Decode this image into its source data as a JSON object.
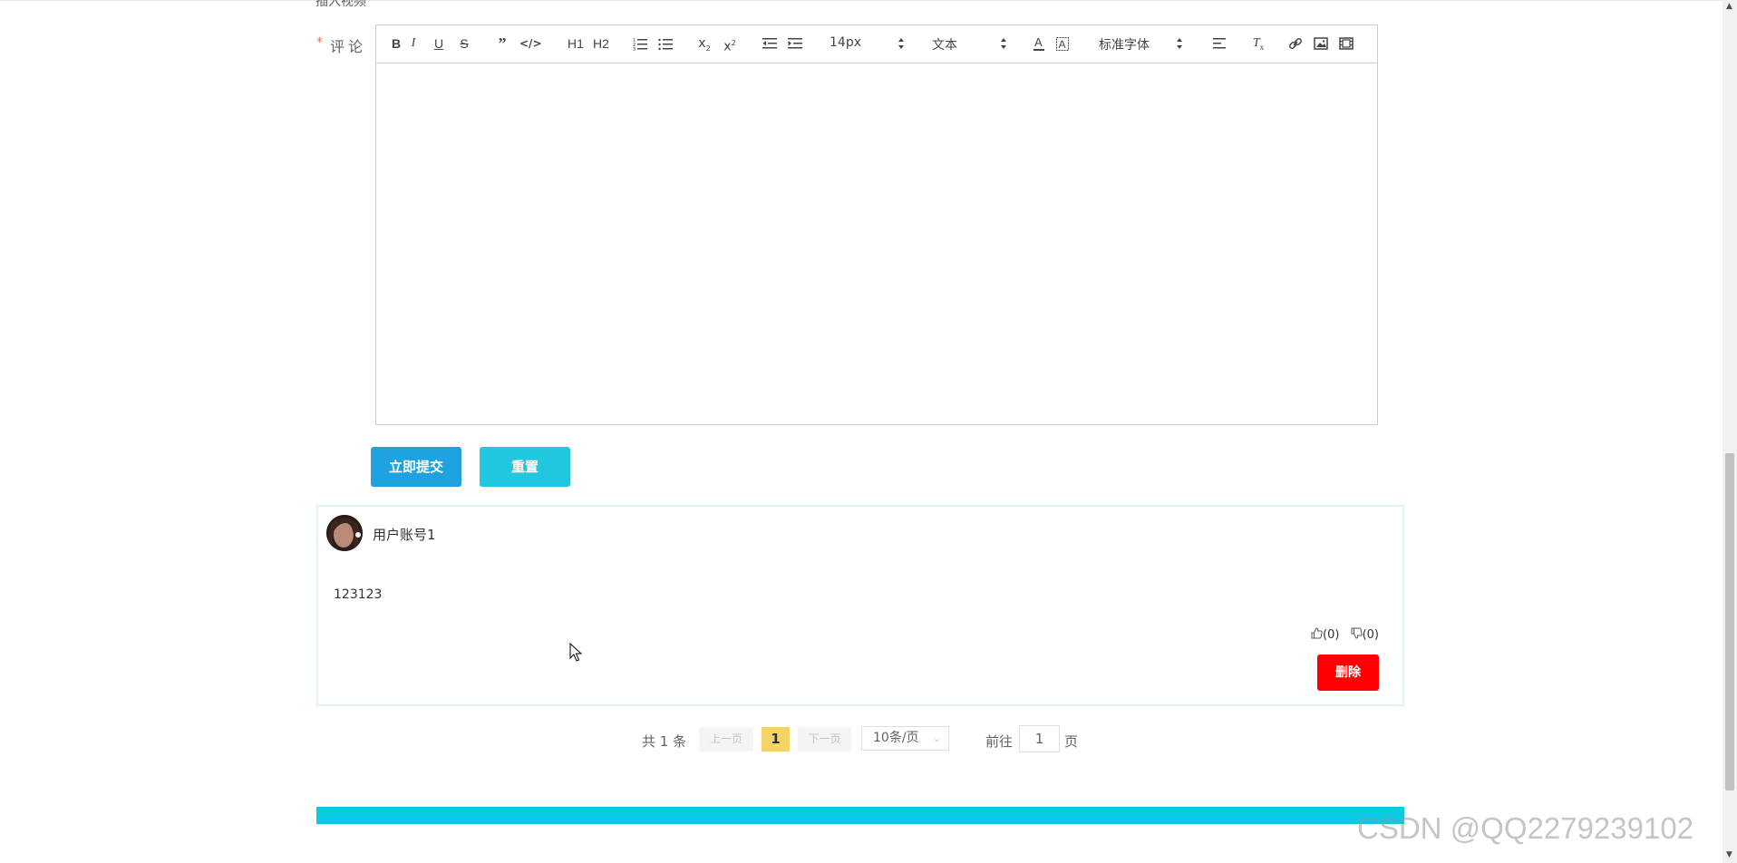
{
  "top": {
    "cut_text": "插入视频"
  },
  "form": {
    "required_mark": "*",
    "comment_label": "评论"
  },
  "toolbar": {
    "font_size": "14px",
    "header_type": "文本",
    "font_family": "标准字体",
    "h1": "H1",
    "h2": "H2"
  },
  "actions": {
    "submit_label": "立即提交",
    "reset_label": "重置"
  },
  "comment": {
    "username": "用户账号1",
    "text": "123123",
    "likes": "(0)",
    "dislikes": "(0)",
    "delete_label": "删除"
  },
  "pagination": {
    "total": "共 1 条",
    "prev": "上一页",
    "current_page": "1",
    "next": "下一页",
    "page_size": "10条/页",
    "goto": "前往",
    "goto_value": "1",
    "page_unit": "页"
  },
  "watermark": "CSDN @QQ2279239102",
  "colors": {
    "submit": "#1fa2e0",
    "reset": "#21c6df",
    "delete": "#ff0000",
    "current_page": "#f6d365",
    "footer": "#0bcbe4"
  }
}
